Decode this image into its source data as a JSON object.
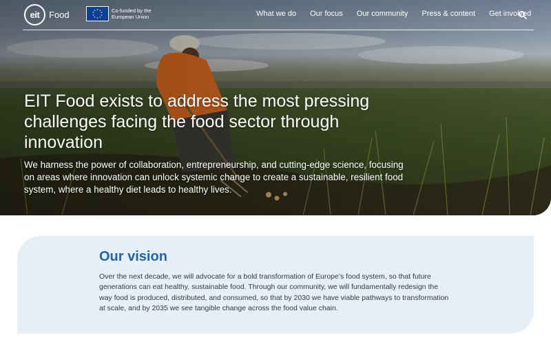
{
  "header": {
    "logo_mark": "eit",
    "logo_word": "Food",
    "eu_badge": "Co-funded by the European Union",
    "nav": [
      {
        "label": "What we do"
      },
      {
        "label": "Our focus"
      },
      {
        "label": "Our community"
      },
      {
        "label": "Press & content"
      },
      {
        "label": "Get involved"
      }
    ],
    "search_icon": "search-icon"
  },
  "hero": {
    "title": "EIT Food exists to address the most pressing challenges facing the food sector through innovation",
    "subtitle": "We harness the power of collaboration, entrepreneurship, and cutting-edge science, focusing on areas where innovation can unlock systemic change to create a sustainable, resilient food system, where a healthy diet leads to healthy lives."
  },
  "vision": {
    "title": "Our vision",
    "body": "Over the next decade, we will advocate for a bold transformation of Europe’s food system, so that future generations can eat healthy, sustainable food. Through our community, we will fundamentally redesign the way food is produced, distributed, and consumed, so that by 2030 we have viable pathways to transformation at scale, and by 2035 we see tangible change across the food value chain."
  },
  "colors": {
    "accent": "#1f64ad",
    "vision_bg": "#e6eef7",
    "eu_blue": "#0a3f9c"
  }
}
